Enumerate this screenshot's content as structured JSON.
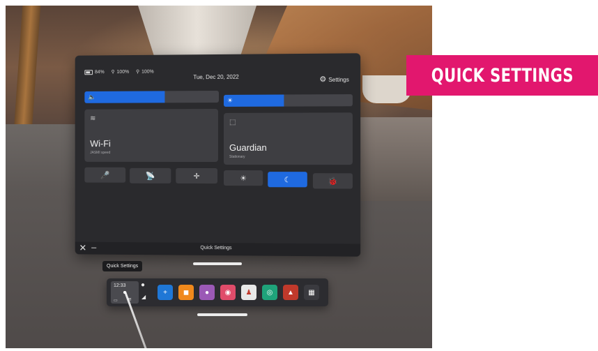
{
  "status_bar": {
    "battery_pct": "84%",
    "controller_left_pct": "100%",
    "controller_right_pct": "100%"
  },
  "date": "Tue, Dec 20, 2022",
  "settings_label": "Settings",
  "sliders": {
    "volume_level": 0.6,
    "brightness_level": 0.47
  },
  "tiles": {
    "wifi": {
      "title": "Wi-Fi",
      "subtitle": "JASMI speed"
    },
    "guardian": {
      "title": "Guardian",
      "subtitle": "Stationary"
    }
  },
  "quick_buttons": [
    {
      "name": "mic",
      "icon": "🎤",
      "active": false
    },
    {
      "name": "cast",
      "icon": "📡",
      "active": false
    },
    {
      "name": "recenter",
      "icon": "✛",
      "active": false
    },
    {
      "name": "light-mode",
      "icon": "☀",
      "active": false
    },
    {
      "name": "night-mode",
      "icon": "☾",
      "active": true
    },
    {
      "name": "debug",
      "icon": "🐞",
      "active": false
    }
  ],
  "footer_title": "Quick Settings",
  "tooltip": "Quick Settings",
  "dock": {
    "time": "12:33",
    "apps": [
      {
        "name": "explore",
        "color": "#1f77d6",
        "glyph": "+"
      },
      {
        "name": "store",
        "color": "#f0891c",
        "glyph": "◼"
      },
      {
        "name": "people",
        "color": "#9b59b6",
        "glyph": "●"
      },
      {
        "name": "camera",
        "color": "#e04c6a",
        "glyph": "◉"
      },
      {
        "name": "game-1",
        "color": "#e8e8e8",
        "glyph": "♟"
      },
      {
        "name": "game-2",
        "color": "#1fa37a",
        "glyph": "◎"
      },
      {
        "name": "game-3",
        "color": "#c0392b",
        "glyph": "▲"
      },
      {
        "name": "app-library",
        "color": "#3a3a3f",
        "glyph": "▦"
      }
    ]
  },
  "banner_text": "QUICK SETTINGS"
}
